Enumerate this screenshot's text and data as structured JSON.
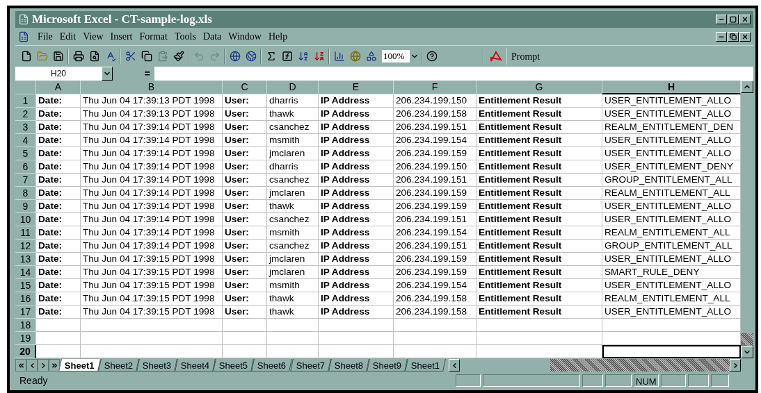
{
  "window": {
    "title": "Microsoft Excel - CT-sample-log.xls"
  },
  "menu_items": [
    "File",
    "Edit",
    "View",
    "Insert",
    "Format",
    "Tools",
    "Data",
    "Window",
    "Help"
  ],
  "toolbar": {
    "zoom": "100%",
    "prompt_button": "Prompt"
  },
  "formula_bar": {
    "name_box": "H20",
    "equals": "="
  },
  "columns": [
    {
      "label": "A",
      "kind": "label",
      "selected": false
    },
    {
      "label": "B",
      "kind": "value",
      "selected": false
    },
    {
      "label": "C",
      "kind": "label",
      "selected": false
    },
    {
      "label": "D",
      "kind": "value",
      "selected": false
    },
    {
      "label": "E",
      "kind": "label",
      "selected": false
    },
    {
      "label": "F",
      "kind": "value",
      "selected": false
    },
    {
      "label": "G",
      "kind": "label",
      "selected": false
    },
    {
      "label": "H",
      "kind": "value",
      "selected": true
    }
  ],
  "rows": [
    {
      "number": "1",
      "selected": false,
      "cells": [
        "Date:",
        "Thu Jun 04 17:39:13 PDT 1998",
        "User:",
        "dharris",
        "IP Address",
        "206.234.199.150",
        "Entitlement Result",
        "USER_ENTITLEMENT_ALLO"
      ]
    },
    {
      "number": "2",
      "selected": false,
      "cells": [
        "Date:",
        "Thu Jun 04 17:39:13 PDT 1998",
        "User:",
        "thawk",
        "IP Address",
        "206.234.199.158",
        "Entitlement Result",
        "USER_ENTITLEMENT_ALLO"
      ]
    },
    {
      "number": "3",
      "selected": false,
      "cells": [
        "Date:",
        "Thu Jun 04 17:39:14 PDT 1998",
        "User:",
        "csanchez",
        "IP Address",
        "206.234.199.151",
        "Entitlement Result",
        "REALM_ENTITLEMENT_DEN"
      ]
    },
    {
      "number": "4",
      "selected": false,
      "cells": [
        "Date:",
        "Thu Jun 04 17:39:14 PDT 1998",
        "User:",
        "msmith",
        "IP Address",
        "206.234.199.154",
        "Entitlement Result",
        "USER_ENTITLEMENT_ALLO"
      ]
    },
    {
      "number": "5",
      "selected": false,
      "cells": [
        "Date:",
        "Thu Jun 04 17:39:14 PDT 1998",
        "User:",
        "jmclaren",
        "IP Address",
        "206.234.199.159",
        "Entitlement Result",
        "USER_ENTITLEMENT_ALLO"
      ]
    },
    {
      "number": "6",
      "selected": false,
      "cells": [
        "Date:",
        "Thu Jun 04 17:39:14 PDT 1998",
        "User:",
        "dharris",
        "IP Address",
        "206.234.199.150",
        "Entitlement Result",
        "USER_ENTITLEMENT_DENY"
      ]
    },
    {
      "number": "7",
      "selected": false,
      "cells": [
        "Date:",
        "Thu Jun 04 17:39:14 PDT 1998",
        "User:",
        "csanchez",
        "IP Address",
        "206.234.199.151",
        "Entitlement Result",
        "GROUP_ENTITLEMENT_ALL"
      ]
    },
    {
      "number": "8",
      "selected": false,
      "cells": [
        "Date:",
        "Thu Jun 04 17:39:14 PDT 1998",
        "User:",
        "jmclaren",
        "IP Address",
        "206.234.199.159",
        "Entitlement Result",
        "REALM_ENTITLEMENT_ALL"
      ]
    },
    {
      "number": "9",
      "selected": false,
      "cells": [
        "Date:",
        "Thu Jun 04 17:39:14 PDT 1998",
        "User:",
        "thawk",
        "IP Address",
        "206.234.199.159",
        "Entitlement Result",
        "USER_ENTITLEMENT_ALLO"
      ]
    },
    {
      "number": "10",
      "selected": false,
      "cells": [
        "Date:",
        "Thu Jun 04 17:39:14 PDT 1998",
        "User:",
        "csanchez",
        "IP Address",
        "206.234.199.151",
        "Entitlement Result",
        "USER_ENTITLEMENT_ALLO"
      ]
    },
    {
      "number": "11",
      "selected": false,
      "cells": [
        "Date:",
        "Thu Jun 04 17:39:14 PDT 1998",
        "User:",
        "msmith",
        "IP Address",
        "206.234.199.154",
        "Entitlement Result",
        "REALM_ENTITLEMENT_ALL"
      ]
    },
    {
      "number": "12",
      "selected": false,
      "cells": [
        "Date:",
        "Thu Jun 04 17:39:14 PDT 1998",
        "User:",
        "csanchez",
        "IP Address",
        "206.234.199.151",
        "Entitlement Result",
        "GROUP_ENTITLEMENT_ALL"
      ]
    },
    {
      "number": "13",
      "selected": false,
      "cells": [
        "Date:",
        "Thu Jun 04 17:39:15 PDT 1998",
        "User:",
        "jmclaren",
        "IP Address",
        "206.234.199.159",
        "Entitlement Result",
        "USER_ENTITLEMENT_ALLO"
      ]
    },
    {
      "number": "14",
      "selected": false,
      "cells": [
        "Date:",
        "Thu Jun 04 17:39:15 PDT 1998",
        "User:",
        "jmclaren",
        "IP Address",
        "206.234.199.159",
        "Entitlement Result",
        "SMART_RULE_DENY"
      ]
    },
    {
      "number": "15",
      "selected": false,
      "cells": [
        "Date:",
        "Thu Jun 04 17:39:15 PDT 1998",
        "User:",
        "msmith",
        "IP Address",
        "206.234.199.154",
        "Entitlement Result",
        "USER_ENTITLEMENT_ALLO"
      ]
    },
    {
      "number": "16",
      "selected": false,
      "cells": [
        "Date:",
        "Thu Jun 04 17:39:15 PDT 1998",
        "User:",
        "thawk",
        "IP Address",
        "206.234.199.158",
        "Entitlement Result",
        "REALM_ENTITLEMENT_ALL"
      ]
    },
    {
      "number": "17",
      "selected": false,
      "cells": [
        "Date:",
        "Thu Jun 04 17:39:15 PDT 1998",
        "User:",
        "thawk",
        "IP Address",
        "206.234.199.158",
        "Entitlement Result",
        "USER_ENTITLEMENT_ALLO"
      ]
    },
    {
      "number": "18",
      "selected": false
    },
    {
      "number": "19",
      "selected": false
    },
    {
      "number": "20",
      "selected": true
    }
  ],
  "sheet_tabs": [
    {
      "label": "Sheet1",
      "selected": true
    },
    {
      "label": "Sheet2",
      "selected": false
    },
    {
      "label": "Sheet3",
      "selected": false
    },
    {
      "label": "Sheet4",
      "selected": false
    },
    {
      "label": "Sheet5",
      "selected": false
    },
    {
      "label": "Sheet6",
      "selected": false
    },
    {
      "label": "Sheet7",
      "selected": false
    },
    {
      "label": "Sheet8",
      "selected": false
    },
    {
      "label": "Sheet9",
      "selected": false
    },
    {
      "label": "Sheet1",
      "selected": false
    }
  ],
  "status_bar": {
    "message": "Ready",
    "indicator": "NUM"
  }
}
